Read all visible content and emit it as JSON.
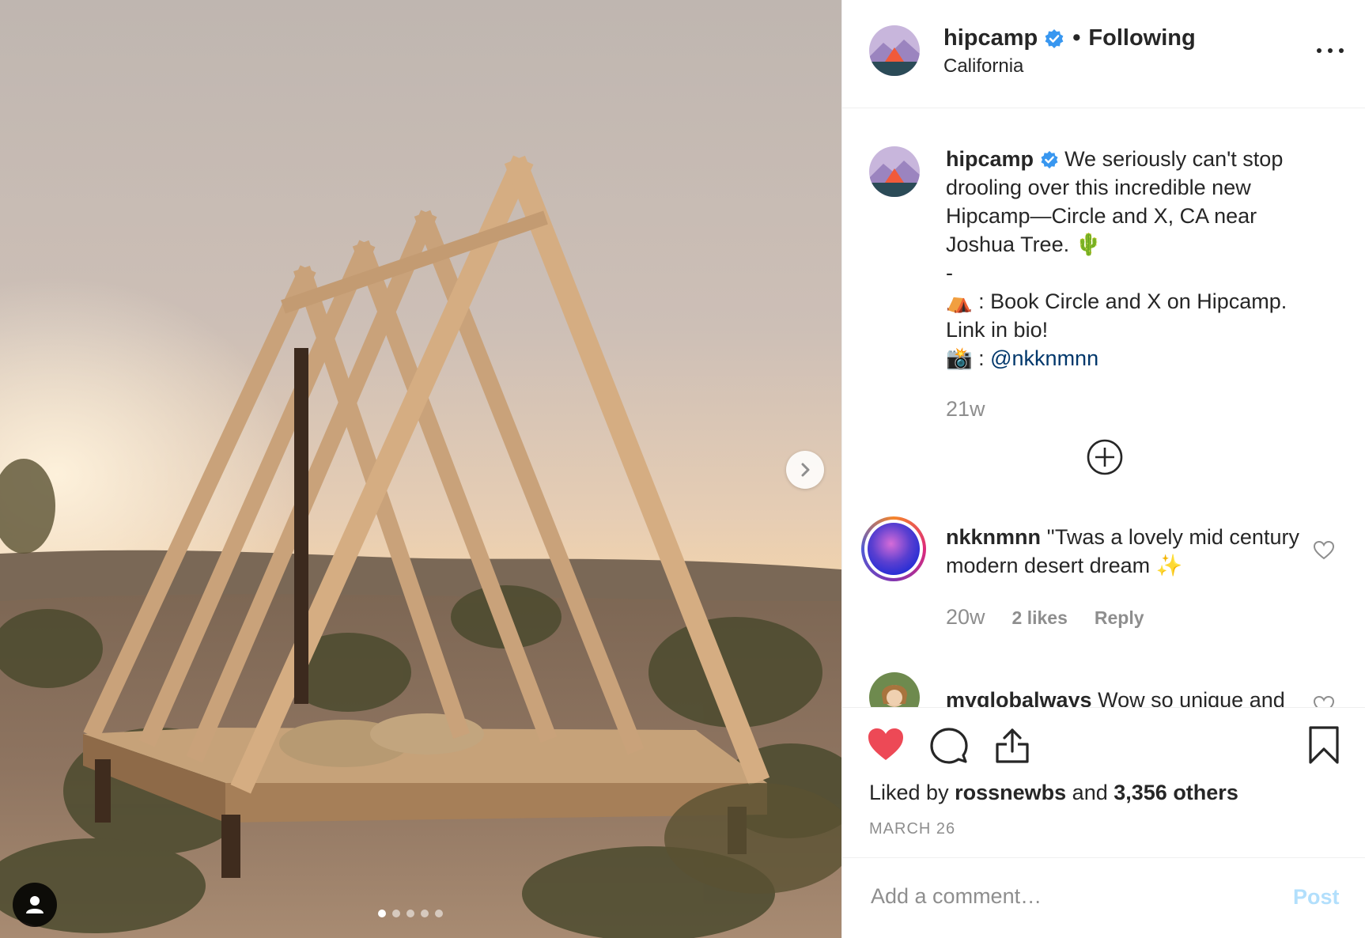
{
  "post": {
    "username": "hipcamp",
    "separator": "•",
    "follow_status": "Following",
    "location": "California",
    "caption_lines": [
      "We seriously can't stop drooling over this incredible new Hipcamp—Circle and X, CA near Joshua Tree. 🌵",
      "-",
      "⛺ : Book Circle and X on Hipcamp. Link in bio!",
      "📸 : "
    ],
    "caption_mention": "@nkknmnn",
    "caption_time": "21w",
    "carousel": {
      "total": 5,
      "active": 1
    }
  },
  "comments": [
    {
      "username": "nkknmnn",
      "text": "''Twas a lovely mid century modern desert dream ✨",
      "time": "20w",
      "likes": "2 likes",
      "reply": "Reply"
    },
    {
      "username": "myglobalways",
      "text": "Wow so unique and"
    }
  ],
  "actions": {
    "liked": true,
    "likes_prefix": "Liked by",
    "likes_user": "rossnewbs",
    "likes_conj": "and",
    "likes_others": "3,356 others",
    "date": "MARCH 26"
  },
  "comment_box": {
    "placeholder": "Add a comment…",
    "post_label": "Post"
  },
  "colors": {
    "heart": "#ed4956",
    "verified": "#3897f0",
    "mention": "#00376b",
    "post_disabled": "#b2dffc"
  },
  "icons": [
    "chevron-right-icon",
    "user-tag-icon",
    "verified-badge-icon",
    "more-options-icon",
    "plus-circle-icon",
    "heart-icon",
    "comment-icon",
    "share-icon",
    "bookmark-icon"
  ]
}
